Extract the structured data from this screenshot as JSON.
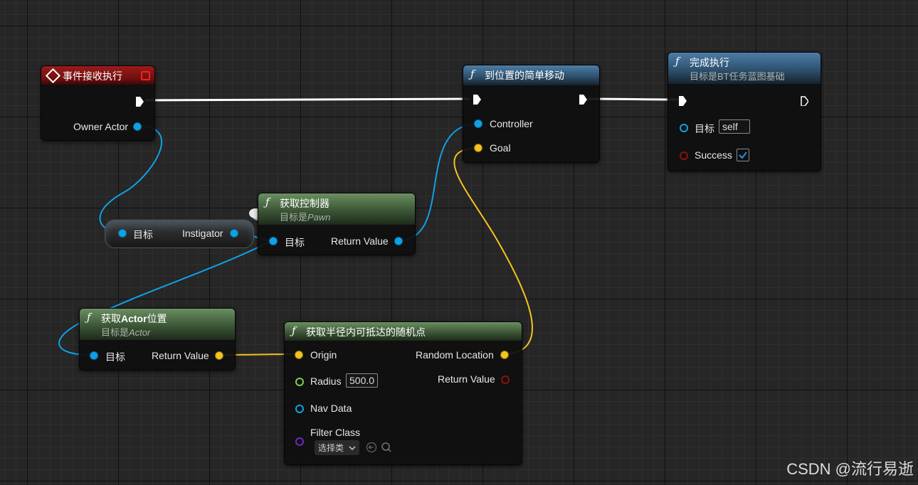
{
  "nodes": {
    "event": {
      "title": "事件接收执行",
      "owner_label": "Owner Actor"
    },
    "move": {
      "title": "到位置的简单移动",
      "controller_label": "Controller",
      "goal_label": "Goal"
    },
    "finish": {
      "title": "完成执行",
      "subtitle": "目标是BT任务蓝图基础",
      "target_label": "目标",
      "target_value": "self",
      "success_label": "Success"
    },
    "get_controller": {
      "title": "获取控制器",
      "subtitle_prefix": "目标是",
      "subtitle_em": "Pawn",
      "target_label": "目标",
      "return_label": "Return Value"
    },
    "cast": {
      "target_label": "目标",
      "out_label": "Instigator"
    },
    "get_actor_loc": {
      "title_prefix": "获取",
      "title_bold": "Actor",
      "title_suffix": "位置",
      "subtitle_prefix": "目标是",
      "subtitle_em": "Actor",
      "target_label": "目标",
      "return_label": "Return Value"
    },
    "random_point": {
      "title": "获取半径内可抵达的随机点",
      "origin_label": "Origin",
      "radius_label": "Radius",
      "radius_value": "500.0",
      "navdata_label": "Nav Data",
      "filter_label": "Filter Class",
      "filter_select": "选择类",
      "random_loc_label": "Random Location",
      "return_label": "Return Value"
    }
  },
  "icons": {
    "function": "ƒ",
    "event": "event-diamond-icon"
  },
  "colors": {
    "object_pin": "#0da2e6",
    "vector_pin": "#f6c220",
    "float_pin": "#7ad24a",
    "bool_pin": "#8a1010",
    "class_pin": "#6b2bc1",
    "exec_wire": "#ffffff"
  },
  "watermark": "CSDN @流行易逝"
}
